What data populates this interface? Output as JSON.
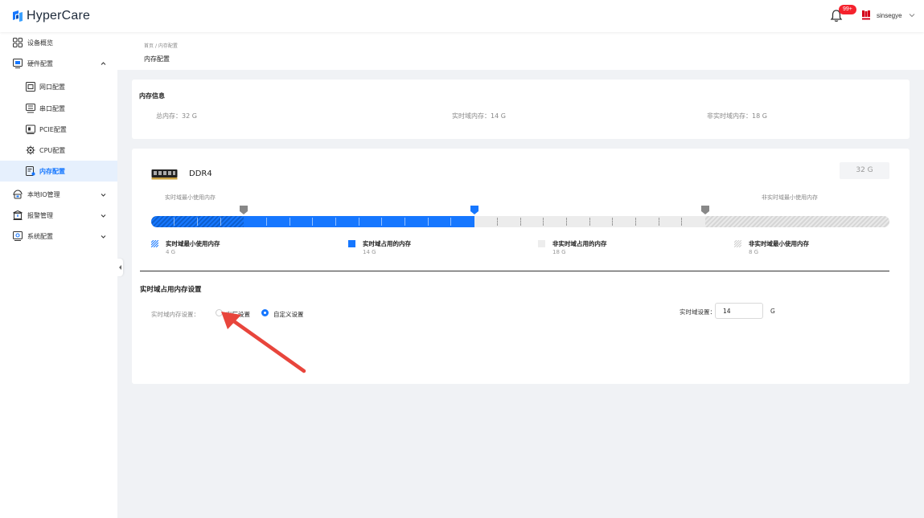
{
  "app": {
    "name": "HyperCare"
  },
  "header": {
    "notification_count": "99+",
    "user_name": "sinsegye",
    "colors": {
      "badge": "#f5222d",
      "accent": "#1677ff"
    }
  },
  "sidebar": {
    "items": [
      {
        "label": "设备概览",
        "icon": "grid-icon"
      },
      {
        "label": "硬件配置",
        "icon": "hardware-icon",
        "expanded": true
      },
      {
        "label": "网口配置",
        "icon": "network-port-icon"
      },
      {
        "label": "串口配置",
        "icon": "serial-port-icon"
      },
      {
        "label": "PCIE配置",
        "icon": "pcie-icon"
      },
      {
        "label": "CPU配置",
        "icon": "cpu-icon"
      },
      {
        "label": "内存配置",
        "icon": "memory-icon",
        "active": true
      },
      {
        "label": "本地IO管理",
        "icon": "io-icon"
      },
      {
        "label": "报警管理",
        "icon": "alarm-icon"
      },
      {
        "label": "系统配置",
        "icon": "settings-icon"
      }
    ]
  },
  "breadcrumb": {
    "home": "首页",
    "sep": "/",
    "current": "内存配置"
  },
  "page": {
    "title": "内存配置"
  },
  "memory_info": {
    "title": "内存信息",
    "total": "总内存：32 G",
    "realtime": "实时域内存：14 G",
    "non_realtime": "非实时域内存：18 G"
  },
  "memory_bar": {
    "module_type": "DDR4",
    "total_label": "32 G",
    "left_caption": "实时域最小使用内存",
    "right_caption": "非实时域最小使用内存",
    "total_gb": 32,
    "realtime_min_gb": 4,
    "realtime_used_gb": 14,
    "non_realtime_used_gb": 18,
    "non_realtime_min_gb": 8
  },
  "legend": [
    {
      "name": "实时域最小使用内存",
      "value": "4 G",
      "swatch": "hatched-blue"
    },
    {
      "name": "实时域占用的内存",
      "value": "14 G",
      "swatch": "blue"
    },
    {
      "name": "非实时域占用的内存",
      "value": "18 G",
      "swatch": "gray"
    },
    {
      "name": "非实时域最小使用内存",
      "value": "8 G",
      "swatch": "hatched-gray"
    }
  ],
  "settings": {
    "section_title": "实时域占用内存设置",
    "mode_label": "实时域内存设置：",
    "option_factory": "出厂设置",
    "option_custom": "自定义设置",
    "selected": "custom",
    "realtime_label": "实时域设置：",
    "realtime_value": "14",
    "unit": "G"
  }
}
